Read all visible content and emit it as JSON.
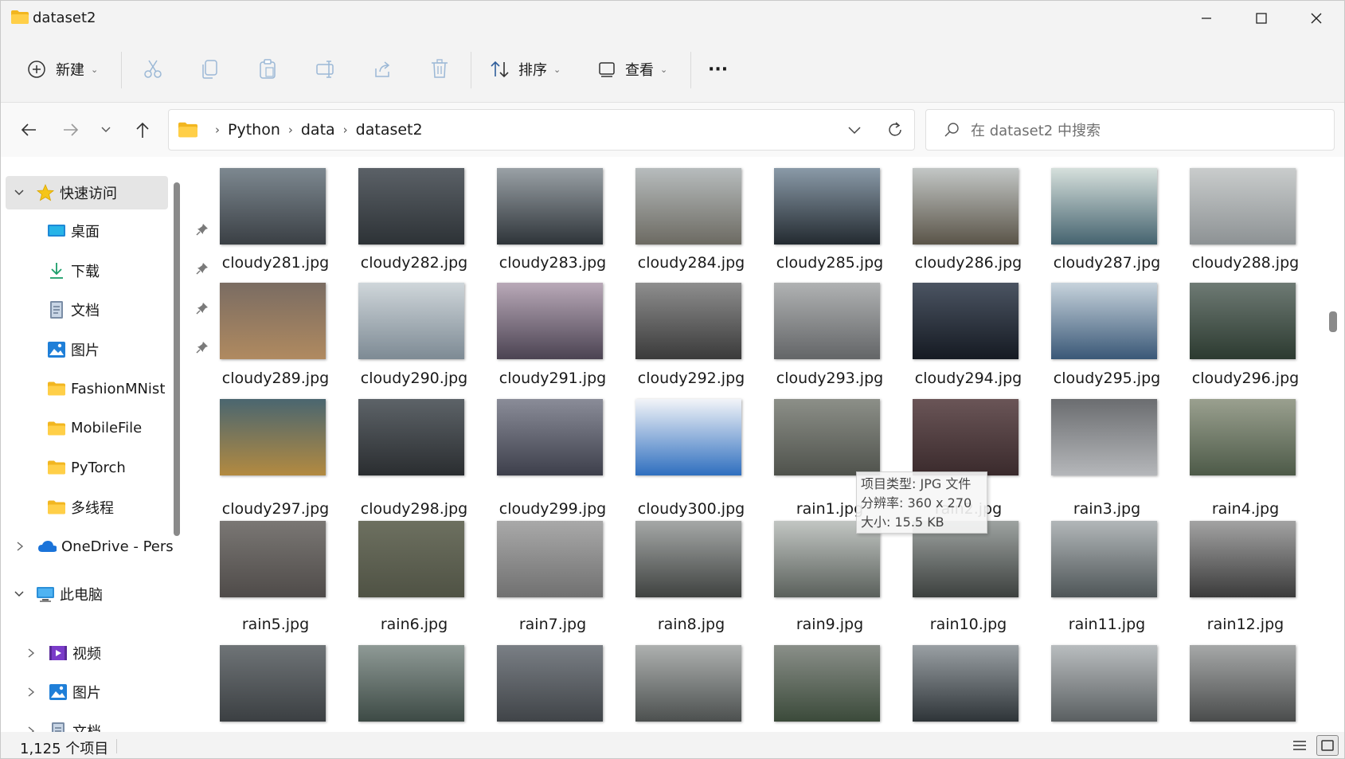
{
  "window": {
    "title": "dataset2"
  },
  "toolbar": {
    "new_label": "新建",
    "sort_label": "排序",
    "view_label": "查看",
    "more_label": "···"
  },
  "address": {
    "crumbs": [
      "Python",
      "data",
      "dataset2"
    ]
  },
  "search": {
    "placeholder": "在 dataset2 中搜索"
  },
  "sidebar": {
    "quick_access": "快速访问",
    "items": [
      {
        "label": "桌面",
        "icon": "desktop-icon",
        "pinned": true
      },
      {
        "label": "下载",
        "icon": "download-icon",
        "pinned": true
      },
      {
        "label": "文档",
        "icon": "document-icon",
        "pinned": true
      },
      {
        "label": "图片",
        "icon": "pictures-icon",
        "pinned": true
      },
      {
        "label": "FashionMNist",
        "icon": "folder-icon",
        "pinned": false
      },
      {
        "label": "MobileFile",
        "icon": "folder-icon",
        "pinned": false
      },
      {
        "label": "PyTorch",
        "icon": "folder-icon",
        "pinned": false
      },
      {
        "label": "多线程",
        "icon": "folder-icon",
        "pinned": false
      }
    ],
    "onedrive": "OneDrive - Pers",
    "this_pc": "此电脑",
    "pc_items": [
      {
        "label": "视频",
        "icon": "video-icon"
      },
      {
        "label": "图片",
        "icon": "pictures-icon"
      },
      {
        "label": "文档",
        "icon": "document-icon"
      }
    ]
  },
  "files": [
    {
      "name": "cloudy281.jpg",
      "c1": "#7d8890",
      "c2": "#3a3f44"
    },
    {
      "name": "cloudy282.jpg",
      "c1": "#5b6167",
      "c2": "#2d3236"
    },
    {
      "name": "cloudy283.jpg",
      "c1": "#9aa1a6",
      "c2": "#2e3439"
    },
    {
      "name": "cloudy284.jpg",
      "c1": "#b7bcbd",
      "c2": "#6c6a62"
    },
    {
      "name": "cloudy285.jpg",
      "c1": "#8a9aa8",
      "c2": "#232a30"
    },
    {
      "name": "cloudy286.jpg",
      "c1": "#c3c7c6",
      "c2": "#5a5448"
    },
    {
      "name": "cloudy287.jpg",
      "c1": "#d6e0dc",
      "c2": "#45636f"
    },
    {
      "name": "cloudy288.jpg",
      "c1": "#c9cccc",
      "c2": "#8d9294"
    },
    {
      "name": "cloudy289.jpg",
      "c1": "#7a6c62",
      "c2": "#b08a60"
    },
    {
      "name": "cloudy290.jpg",
      "c1": "#cfd6da",
      "c2": "#7d8a94"
    },
    {
      "name": "cloudy291.jpg",
      "c1": "#b9a9b8",
      "c2": "#4b4352"
    },
    {
      "name": "cloudy292.jpg",
      "c1": "#8e8e8e",
      "c2": "#3a3a3a"
    },
    {
      "name": "cloudy293.jpg",
      "c1": "#b0b2b3",
      "c2": "#636567"
    },
    {
      "name": "cloudy294.jpg",
      "c1": "#4b5462",
      "c2": "#151a22"
    },
    {
      "name": "cloudy295.jpg",
      "c1": "#c7d3dc",
      "c2": "#3a5877"
    },
    {
      "name": "cloudy296.jpg",
      "c1": "#6e7a74",
      "c2": "#2c3a30"
    },
    {
      "name": "cloudy297.jpg",
      "c1": "#4a6670",
      "c2": "#b38a40"
    },
    {
      "name": "cloudy298.jpg",
      "c1": "#5d6368",
      "c2": "#2a2d30"
    },
    {
      "name": "cloudy299.jpg",
      "c1": "#8a8c98",
      "c2": "#3d3f4b"
    },
    {
      "name": "cloudy300.jpg",
      "c1": "#f2f4f8",
      "c2": "#2f6fbf"
    },
    {
      "name": "rain1.jpg",
      "c1": "#8c8f88",
      "c2": "#4f524c"
    },
    {
      "name": "rain2.jpg",
      "c1": "#6a5557",
      "c2": "#3a2a2c"
    },
    {
      "name": "rain3.jpg",
      "c1": "#6b6d70",
      "c2": "#b5b7ba"
    },
    {
      "name": "rain4.jpg",
      "c1": "#9aa08f",
      "c2": "#4d5a48"
    },
    {
      "name": "rain5.jpg",
      "c1": "#7a7774",
      "c2": "#4f4b49"
    },
    {
      "name": "rain6.jpg",
      "c1": "#6d7060",
      "c2": "#4f5244"
    },
    {
      "name": "rain7.jpg",
      "c1": "#a9a9a9",
      "c2": "#707070"
    },
    {
      "name": "rain8.jpg",
      "c1": "#a5a8a7",
      "c2": "#3f4240"
    },
    {
      "name": "rain9.jpg",
      "c1": "#c2c6c3",
      "c2": "#5a605b"
    },
    {
      "name": "rain10.jpg",
      "c1": "#9ea3a1",
      "c2": "#3c403e"
    },
    {
      "name": "rain11.jpg",
      "c1": "#b2b7b9",
      "c2": "#4e5557"
    },
    {
      "name": "rain12.jpg",
      "c1": "#a3a3a3",
      "c2": "#3b3b3b"
    },
    {
      "name": "",
      "c1": "#6f7477",
      "c2": "#3b3f42"
    },
    {
      "name": "",
      "c1": "#8f9a96",
      "c2": "#3d4a45"
    },
    {
      "name": "",
      "c1": "#7a7f85",
      "c2": "#404448"
    },
    {
      "name": "",
      "c1": "#aeb1b0",
      "c2": "#4c504f"
    },
    {
      "name": "",
      "c1": "#8a8f89",
      "c2": "#3b4a3a"
    },
    {
      "name": "",
      "c1": "#9aa0a4",
      "c2": "#2e3438"
    },
    {
      "name": "",
      "c1": "#b9bdbf",
      "c2": "#5a5f61"
    },
    {
      "name": "",
      "c1": "#a6a8a8",
      "c2": "#4a4c4c"
    }
  ],
  "tooltip": {
    "type": "项目类型: JPG 文件",
    "resolution": "分辨率: 360 x 270",
    "size": "大小: 15.5 KB"
  },
  "status": {
    "count": "1,125 个项目"
  }
}
